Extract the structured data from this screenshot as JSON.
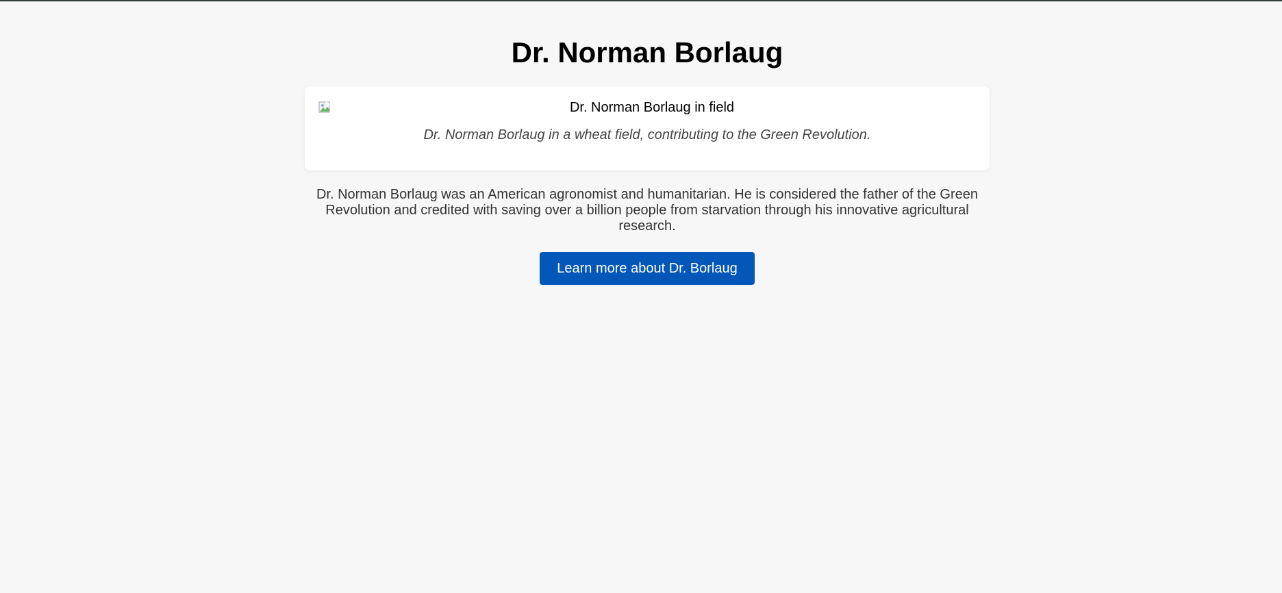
{
  "page": {
    "title": "Dr. Norman Borlaug"
  },
  "image": {
    "alt": "Dr. Norman Borlaug in field",
    "caption": "Dr. Norman Borlaug in a wheat field, contributing to the Green Revolution.",
    "icon": "broken-image-icon"
  },
  "bio": {
    "text": "Dr. Norman Borlaug was an American agronomist and humanitarian. He is considered the father of the Green Revolution and credited with saving over a billion people from starvation through his innovative agricultural research."
  },
  "cta": {
    "label": "Learn more about Dr. Borlaug"
  },
  "colors": {
    "background": "#f7f7f7",
    "button": "#0257b8",
    "card": "#ffffff"
  }
}
